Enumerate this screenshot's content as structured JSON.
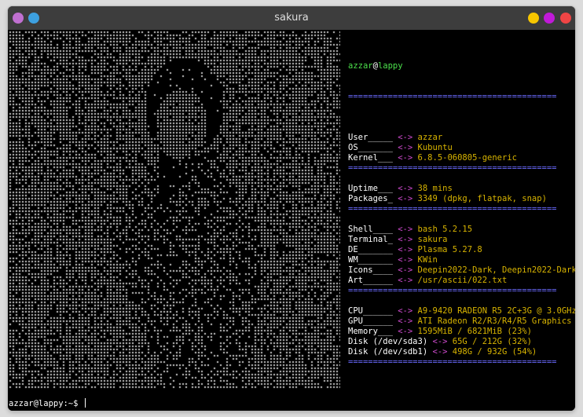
{
  "window": {
    "title": "sakura",
    "left_buttons": [
      {
        "name": "menu-icon",
        "color": "#c070d0"
      },
      {
        "name": "sticky-icon",
        "color": "#3da0e0"
      }
    ],
    "right_buttons": [
      {
        "name": "minimize-icon",
        "color": "#f7c600"
      },
      {
        "name": "maximize-icon",
        "color": "#c01ad8"
      },
      {
        "name": "close-icon",
        "color": "#f04545"
      }
    ]
  },
  "sysinfo": {
    "user": "azzar",
    "at": "@",
    "host": "lappy",
    "separator": "==========================================",
    "arrow": "<->",
    "groups": [
      [
        {
          "key": "User_____",
          "value": "azzar"
        },
        {
          "key": "OS_______",
          "value": "Kubuntu"
        },
        {
          "key": "Kernel___",
          "value": "6.8.5-060805-generic"
        }
      ],
      [
        {
          "key": "Uptime___",
          "value": "38 mins"
        },
        {
          "key": "Packages_",
          "value": "3349 (dpkg, flatpak, snap)"
        }
      ],
      [
        {
          "key": "Shell____",
          "value": "bash 5.2.15"
        },
        {
          "key": "Terminal_",
          "value": "sakura"
        },
        {
          "key": "DE_______",
          "value": "Plasma 5.27.8"
        },
        {
          "key": "WM_______",
          "value": "KWin"
        },
        {
          "key": "Icons____",
          "value": "Deepin2022-Dark, Deepin2022-Dark"
        },
        {
          "key": "Art______",
          "value": "/usr/ascii/022.txt"
        }
      ],
      [
        {
          "key": "CPU______",
          "value": "A9-9420 RADEON R5 2C+3G @ 3.0GHz"
        },
        {
          "key": "GPU______",
          "value": "ATI Radeon R2/R3/R4/R5 Graphics"
        },
        {
          "key": "Memory___",
          "value": "1595MiB / 6821MiB (23%)"
        },
        {
          "key": "Disk (/dev/sda3)",
          "value": "65G / 212G (32%)"
        },
        {
          "key": "Disk (/dev/sdb1)",
          "value": "498G / 932G (54%)"
        }
      ]
    ]
  },
  "prompt": {
    "text": "azzar@lappy:~$ "
  },
  "colors": {
    "titlebar": "#3d3d3d",
    "username": "#4be04b",
    "separator": "#6b6bff",
    "arrow": "#d04bd0",
    "value": "#d8b400",
    "art_dots": "#c8c8c8"
  }
}
